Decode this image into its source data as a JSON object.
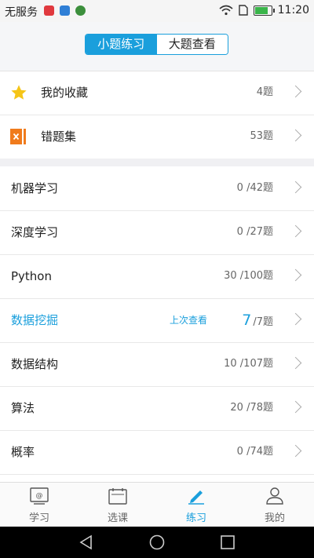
{
  "status_bar": {
    "carrier": "无服务",
    "time": "11:20"
  },
  "segment": {
    "left_label": "小题练习",
    "right_label": "大题查看",
    "active": "left"
  },
  "special_rows": [
    {
      "label": "我的收藏",
      "count": "4题",
      "icon": "star-icon"
    },
    {
      "label": "错题集",
      "count": "53题",
      "icon": "error-book-icon"
    }
  ],
  "subjects": [
    {
      "label": "机器学习",
      "count": "0 /42题"
    },
    {
      "label": "深度学习",
      "count": "0 /27题"
    },
    {
      "label": "Python",
      "count": "30 /100题"
    },
    {
      "label": "数据挖掘",
      "done": "7",
      "total": "/7题",
      "last_view": "上次查看",
      "highlight": true
    },
    {
      "label": "数据结构",
      "count": "10 /107题"
    },
    {
      "label": "算法",
      "count": "20 /78题"
    },
    {
      "label": "概率",
      "count": "0 /74题"
    }
  ],
  "tabs": [
    {
      "label": "学习",
      "icon": "study-icon"
    },
    {
      "label": "选课",
      "icon": "calendar-icon"
    },
    {
      "label": "练习",
      "icon": "pencil-icon",
      "active": true
    },
    {
      "label": "我的",
      "icon": "profile-icon"
    }
  ],
  "colors": {
    "accent": "#1a9fdc",
    "star": "#f5c518",
    "error_icon": "#f07b1c"
  }
}
